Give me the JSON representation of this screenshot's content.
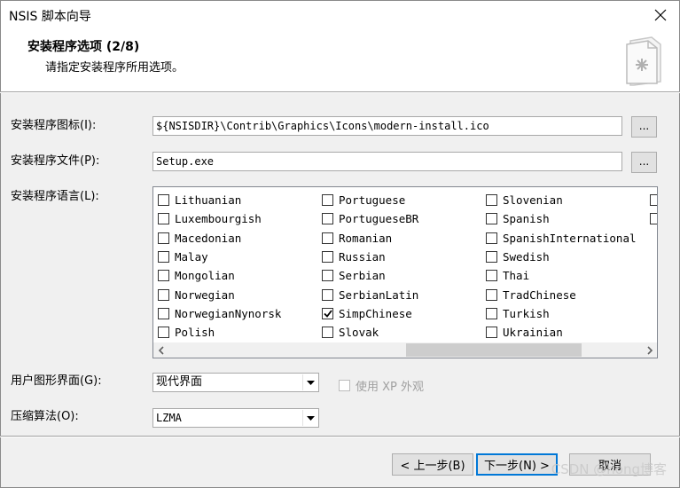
{
  "window": {
    "title": "NSIS 脚本向导"
  },
  "header": {
    "title": "安装程序选项 (2/8)",
    "subtitle": "请指定安装程序所用选项。"
  },
  "form": {
    "icon_label": "安装程序图标(I):",
    "icon_value": "${NSISDIR}\\Contrib\\Graphics\\Icons\\modern-install.ico",
    "browse_label": "...",
    "file_label": "安装程序文件(P):",
    "file_value": "Setup.exe",
    "lang_label": "安装程序语言(L):",
    "ui_label": "用户图形界面(G):",
    "ui_value": "现代界面",
    "xp_label": "使用 XP 外观",
    "compress_label": "压缩算法(O):",
    "compress_value": "LZMA"
  },
  "languages": {
    "col1": [
      {
        "name": "Lithuanian",
        "checked": false
      },
      {
        "name": "Luxembourgish",
        "checked": false
      },
      {
        "name": "Macedonian",
        "checked": false
      },
      {
        "name": "Malay",
        "checked": false
      },
      {
        "name": "Mongolian",
        "checked": false
      },
      {
        "name": "Norwegian",
        "checked": false
      },
      {
        "name": "NorwegianNynorsk",
        "checked": false
      },
      {
        "name": "Polish",
        "checked": false
      }
    ],
    "col2": [
      {
        "name": "Portuguese",
        "checked": false
      },
      {
        "name": "PortugueseBR",
        "checked": false
      },
      {
        "name": "Romanian",
        "checked": false
      },
      {
        "name": "Russian",
        "checked": false
      },
      {
        "name": "Serbian",
        "checked": false
      },
      {
        "name": "SerbianLatin",
        "checked": false
      },
      {
        "name": "SimpChinese",
        "checked": true
      },
      {
        "name": "Slovak",
        "checked": false
      }
    ],
    "col3": [
      {
        "name": "Slovenian",
        "checked": false
      },
      {
        "name": "Spanish",
        "checked": false
      },
      {
        "name": "SpanishInternational",
        "checked": false
      },
      {
        "name": "Swedish",
        "checked": false
      },
      {
        "name": "Thai",
        "checked": false
      },
      {
        "name": "TradChinese",
        "checked": false
      },
      {
        "name": "Turkish",
        "checked": false
      },
      {
        "name": "Ukrainian",
        "checked": false
      }
    ]
  },
  "buttons": {
    "back": "< 上一步(B)",
    "next": "下一步(N) >",
    "cancel": "取消"
  },
  "watermark": "CSDN @hong博客"
}
